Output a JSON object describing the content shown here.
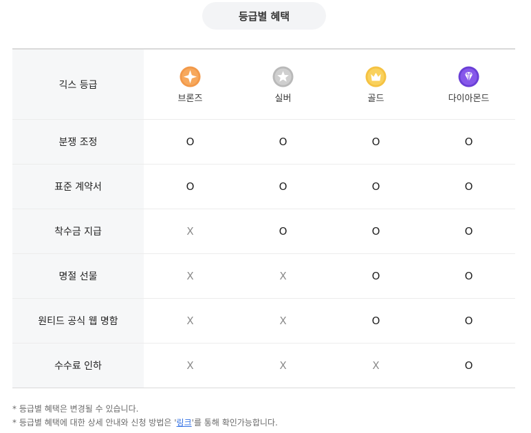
{
  "title": "등급별 혜택",
  "header": {
    "label": "긱스 등급",
    "grades": [
      {
        "name": "브론즈",
        "icon": "bronze-sparkle-icon",
        "color": "#f2994a"
      },
      {
        "name": "실버",
        "icon": "silver-star-icon",
        "color": "#bdbdbd"
      },
      {
        "name": "골드",
        "icon": "gold-crown-icon",
        "color": "#f7c948"
      },
      {
        "name": "다이아몬드",
        "icon": "diamond-icon",
        "color": "#7b4ee3"
      }
    ]
  },
  "rows": [
    {
      "label": "분쟁 조정",
      "values": [
        "O",
        "O",
        "O",
        "O"
      ]
    },
    {
      "label": "표준 계약서",
      "values": [
        "O",
        "O",
        "O",
        "O"
      ]
    },
    {
      "label": "착수금 지급",
      "values": [
        "X",
        "O",
        "O",
        "O"
      ]
    },
    {
      "label": "명절 선물",
      "values": [
        "X",
        "X",
        "O",
        "O"
      ]
    },
    {
      "label": "원티드 공식 웹 명함",
      "values": [
        "X",
        "X",
        "O",
        "O"
      ]
    },
    {
      "label": "수수료 인하",
      "values": [
        "X",
        "X",
        "X",
        "O"
      ]
    }
  ],
  "notes": {
    "line1": "* 등급별 혜택은 변경될 수 있습니다.",
    "line2_prefix": "* 등급별 혜택에 대한 상세 안내와 신청 방법은 '",
    "line2_link": "링크",
    "line2_suffix": "'를 통해 확인가능합니다."
  }
}
